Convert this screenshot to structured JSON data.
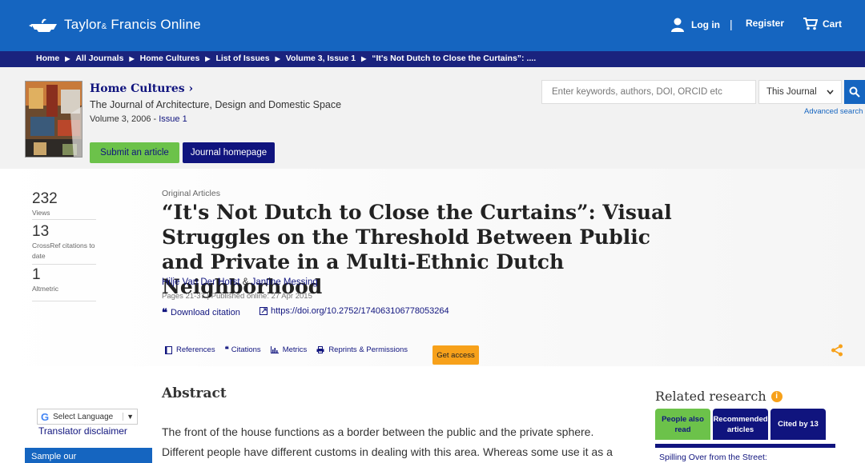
{
  "brand": {
    "name_part1": "Taylor",
    "amp": "&",
    "name_part2": "Francis Online"
  },
  "account": {
    "login": "Log in",
    "separator": "|",
    "register": "Register",
    "cart": "Cart"
  },
  "breadcrumb": [
    "Home",
    "All Journals",
    "Home Cultures",
    "List of Issues",
    "Volume 3, Issue 1",
    "“It's Not Dutch to Close the Curtains”: ...."
  ],
  "journal": {
    "title": "Home Cultures",
    "title_suffix": "›",
    "subtitle": "The Journal of Architecture, Design and Domestic Space",
    "volume": "Volume 3, 2006 - ",
    "issue": "Issue 1",
    "submit_label": "Submit an article",
    "homepage_label": "Journal homepage"
  },
  "search": {
    "placeholder": "Enter keywords, authors, DOI, ORCID etc",
    "scope": "This Journal",
    "advanced": "Advanced search"
  },
  "metrics": [
    {
      "value": "232",
      "label": "Views"
    },
    {
      "value": "13",
      "label": "CrossRef citations to date"
    },
    {
      "value": "1",
      "label": "Altmetric"
    }
  ],
  "article": {
    "category": "Original Articles",
    "title": "“It's Not Dutch to Close the Curtains”: Visual Struggles on the Threshold Between Public and Private in a Multi-Ethnic Dutch Neighborhood",
    "author1": "Hilje Van Der Horst",
    "author_sep": " & ",
    "author2": "Jantine Messing",
    "pages": "Pages 21-37 | Published online: 27 Apr 2015",
    "download_citation": "Download citation",
    "doi": "https://doi.org/10.2752/174063106778053264"
  },
  "tools": {
    "references": "References",
    "citations": "Citations",
    "metrics": "Metrics",
    "reprints": "Reprints & Permissions",
    "get_access": "Get access"
  },
  "abstract": {
    "heading": "Abstract",
    "text": "The front of the house functions as a border between the public and the private sphere. Different people have different customs in dealing with this area. Whereas some use it as a"
  },
  "translator": {
    "select": "Select Language",
    "caret": "▼",
    "disclaimer": "Translator disclaimer"
  },
  "sample": "Sample our",
  "related": {
    "heading": "Related research",
    "tabs": [
      "People also read",
      "Recommended articles",
      "Cited by 13"
    ],
    "first": "Spilling Over from the Street:"
  },
  "colors": {
    "primary": "#1565c0",
    "navy": "#10147e",
    "green": "#6cc24a",
    "orange": "#f7a11a"
  }
}
